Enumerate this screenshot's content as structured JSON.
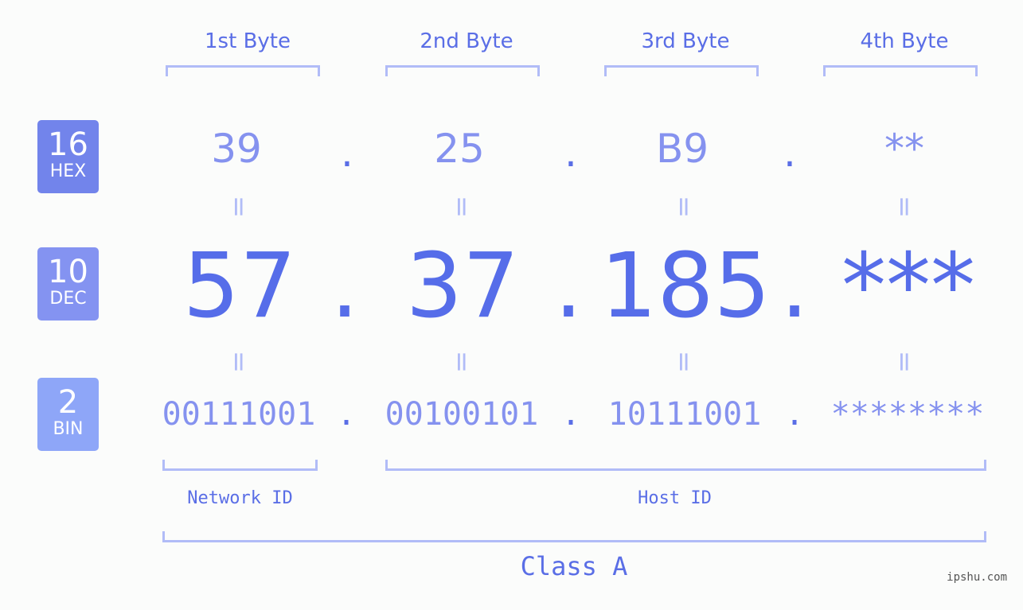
{
  "colors": {
    "hex_badge": "#7284eb",
    "dec_badge": "#8493f1",
    "bin_badge": "#8ea6f8",
    "accent": "#566de9",
    "muted": "#8592ef",
    "bracket": "#b1bcf7"
  },
  "headers": [
    "1st Byte",
    "2nd Byte",
    "3rd Byte",
    "4th Byte"
  ],
  "badges": {
    "hex": {
      "num": "16",
      "label": "HEX"
    },
    "dec": {
      "num": "10",
      "label": "DEC"
    },
    "bin": {
      "num": "2",
      "label": "BIN"
    }
  },
  "hex": [
    "39",
    "25",
    "B9",
    "**"
  ],
  "dec": [
    "57",
    "37",
    "185",
    "***"
  ],
  "bin": [
    "00111001",
    "00100101",
    "10111001",
    "********"
  ],
  "separator": ".",
  "equals": "=",
  "network_id_label": "Network ID",
  "host_id_label": "Host ID",
  "class_label": "Class A",
  "brand": "ipshu.com"
}
